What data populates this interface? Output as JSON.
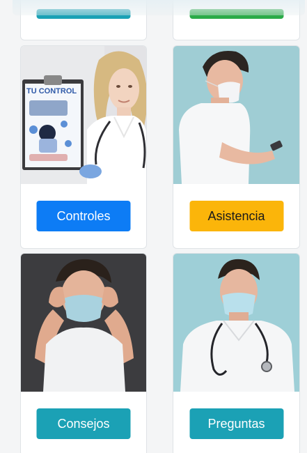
{
  "colors": {
    "primary": "#0d7cf5",
    "warning": "#fbb50a",
    "info": "#1ba1b5",
    "success": "#2bab49"
  },
  "cards": [
    {
      "label": "Controles",
      "button_color": "#0d7cf5",
      "text_color": "#ffffff",
      "image_icon": "doctor-with-clipboard-photo",
      "clipboard_title": "TU CONTROL"
    },
    {
      "label": "Asistencia",
      "button_color": "#fbb50a",
      "text_color": "#1a1a1a",
      "image_icon": "doctor-with-phone-photo"
    },
    {
      "label": "Consejos",
      "button_color": "#1ba1b5",
      "text_color": "#ffffff",
      "image_icon": "doctor-with-mask-photo"
    },
    {
      "label": "Preguntas",
      "button_color": "#1ba1b5",
      "text_color": "#ffffff",
      "image_icon": "doctor-with-stethoscope-photo"
    }
  ]
}
